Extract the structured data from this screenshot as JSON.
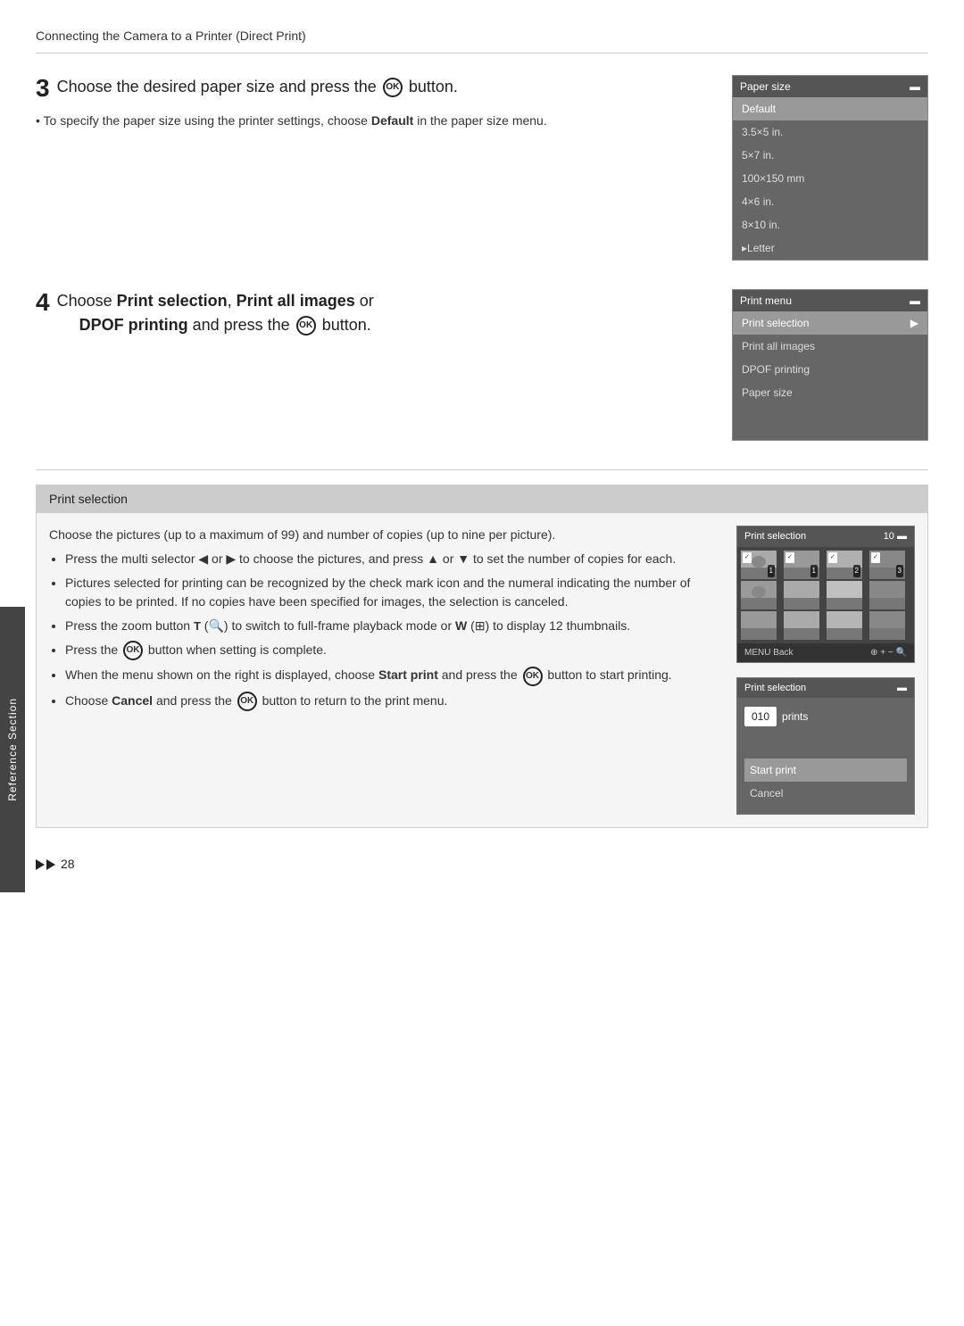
{
  "breadcrumb": "Connecting the Camera to a Printer (Direct Print)",
  "side_tab": "Reference Section",
  "step3": {
    "number": "3",
    "title": "Choose the desired paper size and press the",
    "title_suffix": " button.",
    "bullet": "To specify the paper size using the printer settings, choose Default in the paper size menu.",
    "bullet_bold": "Default",
    "screen": {
      "title": "Paper size",
      "items": [
        {
          "label": "Default",
          "highlighted": true
        },
        {
          "label": "3.5×5 in.",
          "highlighted": false
        },
        {
          "label": "5×7 in.",
          "highlighted": false
        },
        {
          "label": "100×150 mm",
          "highlighted": false
        },
        {
          "label": "4×6 in.",
          "highlighted": false
        },
        {
          "label": "8×10 in.",
          "highlighted": false
        },
        {
          "label": "Letter",
          "highlighted": false
        }
      ]
    }
  },
  "step4": {
    "number": "4",
    "title_prefix": "Choose ",
    "bold1": "Print selection",
    "sep1": ", ",
    "bold2": "Print all images",
    "middle": " or",
    "bold3": "DPOF printing",
    "title_suffix": " and press the",
    "title_end": " button.",
    "screen": {
      "title": "Print menu",
      "items": [
        {
          "label": "Print selection",
          "arrow": true,
          "highlighted": true
        },
        {
          "label": "Print all images",
          "highlighted": false
        },
        {
          "label": "DPOF printing",
          "highlighted": false
        },
        {
          "label": "Paper size",
          "highlighted": false
        }
      ]
    }
  },
  "print_selection_section": {
    "header": "Print selection",
    "intro": "Choose the pictures (up to a maximum of 99) and number of copies (up to nine per picture).",
    "bullets": [
      "Press the multi selector ◀ or ▶ to choose the pictures, and press ▲ or ▼ to set the number of copies for each.",
      "Pictures selected for printing can be recognized by the check mark icon and the numeral indicating the number of copies to be printed. If no copies have been specified for images, the selection is canceled.",
      "Press the zoom button T (Q) to switch to full-frame playback mode or W (⊞) to display 12 thumbnails.",
      "Press the OK button when setting is complete.",
      "When the menu shown on the right is displayed, choose Start print and press the OK button to start printing.",
      "Choose Cancel and press the OK button to return to the print menu."
    ],
    "bold_start_print": "Start print",
    "bold_cancel": "Cancel",
    "thumb_screen": {
      "title": "Print selection",
      "count": "10",
      "footer_left": "MENU Back",
      "footer_right": "⊕+− 🔍"
    },
    "confirm_screen": {
      "title": "Print selection",
      "prints_value": "010",
      "prints_label": "prints",
      "menu_items": [
        {
          "label": "Start print",
          "highlighted": true
        },
        {
          "label": "Cancel",
          "highlighted": false
        }
      ]
    }
  },
  "footer": {
    "page": "28"
  }
}
